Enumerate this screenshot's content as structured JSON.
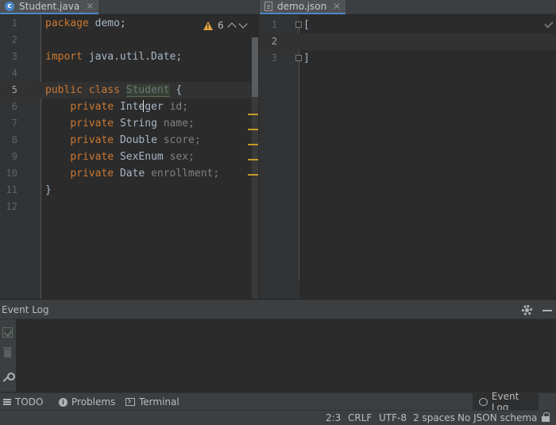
{
  "tabs": {
    "left": {
      "label": "Student.java",
      "icon": "java-class-icon"
    },
    "right": {
      "label": "demo.json",
      "icon": "json-file-icon"
    }
  },
  "editor_left": {
    "inspection": {
      "warning_count": "6"
    },
    "lines": [
      {
        "num": "1",
        "text": "package demo;"
      },
      {
        "num": "2",
        "text": ""
      },
      {
        "num": "3",
        "text": "import java.util.Date;"
      },
      {
        "num": "4",
        "text": ""
      },
      {
        "num": "5",
        "text": "public class Student {"
      },
      {
        "num": "6",
        "text": "    private Integer id;"
      },
      {
        "num": "7",
        "text": "    private String name;"
      },
      {
        "num": "8",
        "text": "    private Double score;"
      },
      {
        "num": "9",
        "text": "    private SexEnum sex;"
      },
      {
        "num": "10",
        "text": "    private Date enrollment;"
      },
      {
        "num": "11",
        "text": "}"
      },
      {
        "num": "12",
        "text": ""
      }
    ],
    "tokens": {
      "package_kw": "package",
      "package_name": " demo;",
      "import_kw": "import",
      "import_path": " java.util.Date;",
      "public_kw": "public",
      "class_kw": "class",
      "class_name": "Student",
      "open_brace": " {",
      "private_kw": "private",
      "types": [
        "Integer",
        "String",
        "Double",
        "SexEnum",
        "Date"
      ],
      "fields": [
        "id;",
        "name;",
        "score;",
        "sex;",
        "enrollment;"
      ],
      "close_brace": "}"
    }
  },
  "editor_right": {
    "lines": [
      {
        "num": "1",
        "text": "["
      },
      {
        "num": "2",
        "text": ""
      },
      {
        "num": "3",
        "text": "]"
      }
    ]
  },
  "event_log": {
    "title": "Event Log"
  },
  "tool_windows": {
    "todo": "TODO",
    "problems": "Problems",
    "terminal": "Terminal",
    "event_log": "Event Log"
  },
  "status_bar": {
    "position": "2:3",
    "line_separator": "CRLF",
    "encoding": "UTF-8",
    "indent": "2 spaces",
    "json_schema": "No JSON schema"
  },
  "colors": {
    "background": "#2b2b2b",
    "keyword": "#cc7832",
    "text": "#a9b7c6",
    "unused": "#72737a",
    "warning": "#e6a53e",
    "accent": "#4a88c7"
  }
}
